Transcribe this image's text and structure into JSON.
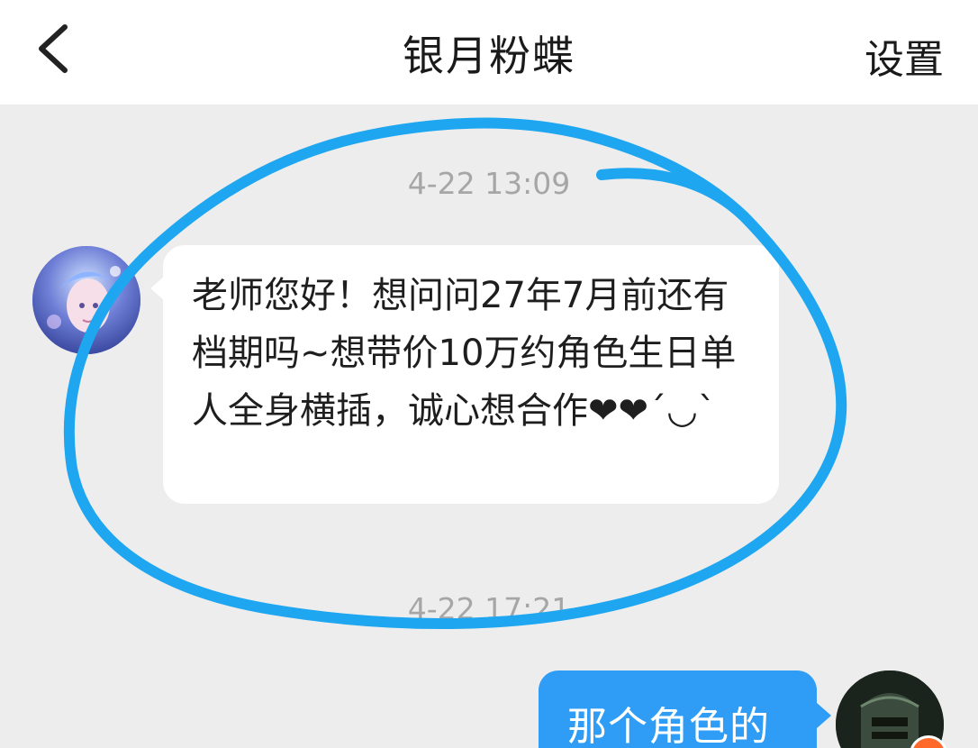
{
  "header": {
    "back_icon": "chevron-left-icon",
    "title": "银月粉蝶",
    "settings_label": "设置"
  },
  "chat": {
    "messages": [
      {
        "timestamp": "4-22 13:09",
        "from": "other",
        "text": "老师您好！想问问27年7月前还有档期吗~想带价10万约角色生日单人全身横插，诚心想合作❤❤´◡`"
      },
      {
        "timestamp": "4-22 17:21",
        "from": "self",
        "text": "那个角色的"
      }
    ]
  },
  "colors": {
    "background": "#ededed",
    "header_bg": "#ffffff",
    "bubble_in": "#ffffff",
    "bubble_out": "#2f9cf5",
    "timestamp": "#a6a6a6",
    "annotation_circle": "#1ea6f0",
    "badge": "#ff6a2a"
  }
}
